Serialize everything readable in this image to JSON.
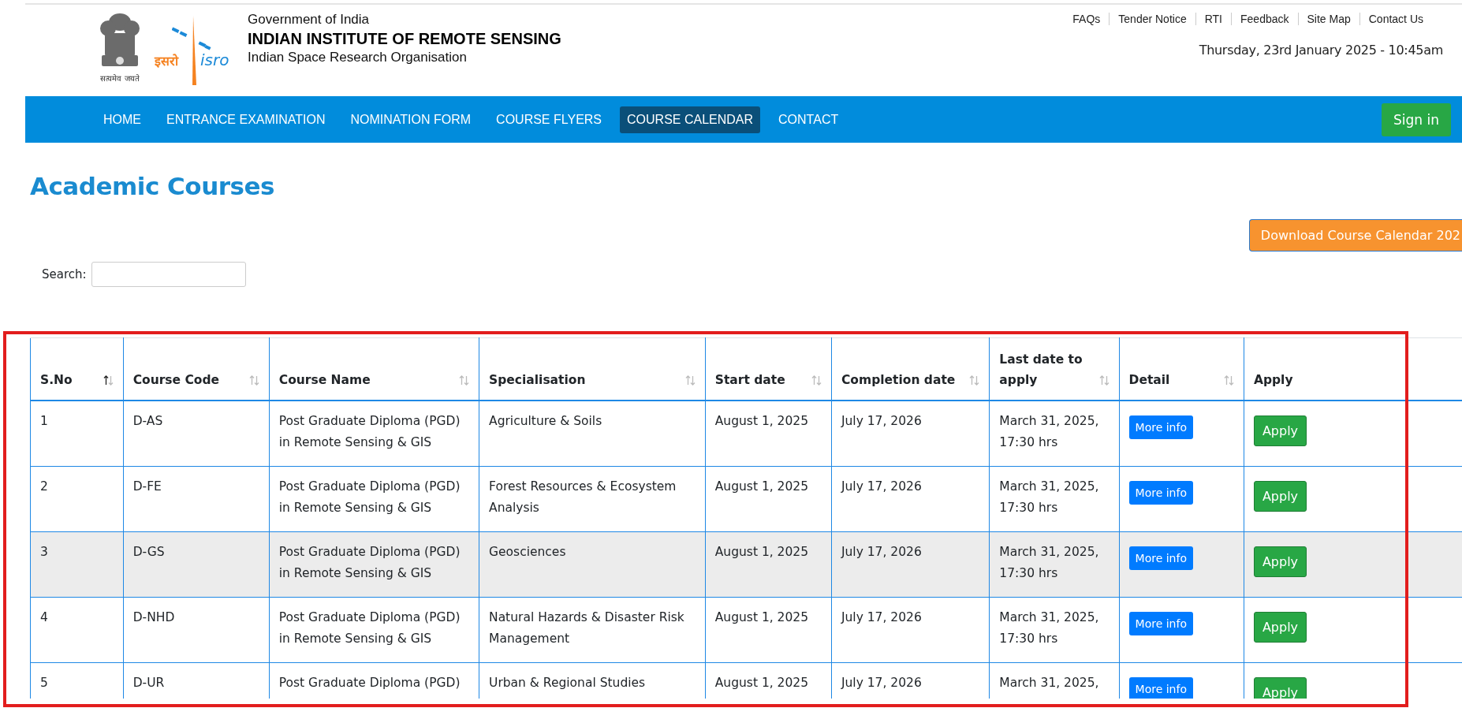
{
  "header": {
    "emblem_motto": "सत्यमेव जयते",
    "isro_logo": {
      "hindi": "इसरो",
      "latin": "isro"
    },
    "org_line": "Government of India",
    "institute": "INDIAN INSTITUTE OF REMOTE SENSING",
    "parent_org": "Indian Space Research Organisation",
    "top_links": [
      "FAQs",
      "Tender Notice",
      "RTI",
      "Feedback",
      "Site Map",
      "Contact Us"
    ],
    "datetime": "Thursday, 23rd January 2025 - 10:45am"
  },
  "nav": {
    "items": [
      {
        "label": "HOME",
        "selected": false
      },
      {
        "label": "ENTRANCE EXAMINATION",
        "selected": false
      },
      {
        "label": "NOMINATION FORM",
        "selected": false
      },
      {
        "label": "COURSE FLYERS",
        "selected": false
      },
      {
        "label": "COURSE CALENDAR",
        "selected": true
      },
      {
        "label": "CONTACT",
        "selected": false
      }
    ],
    "sign_in": "Sign in"
  },
  "page_title": "Academic Courses",
  "download_button": "Download Course Calendar 202",
  "search": {
    "label": "Search:"
  },
  "table": {
    "columns": [
      {
        "label": "S.No",
        "sorted": true
      },
      {
        "label": "Course Code",
        "sorted": false
      },
      {
        "label": "Course Name",
        "sorted": false
      },
      {
        "label": "Specialisation",
        "sorted": false
      },
      {
        "label": "Start date",
        "sorted": false
      },
      {
        "label": "Completion date",
        "sorted": false
      },
      {
        "label": "Last date to apply",
        "sorted": false
      },
      {
        "label": "Detail",
        "sorted": false
      },
      {
        "label": "Apply"
      }
    ],
    "rows": [
      {
        "sno": "1",
        "code": "D-AS",
        "name": "Post Graduate Diploma (PGD) in Remote Sensing & GIS",
        "specialisation": "Agriculture & Soils",
        "start": "August 1, 2025",
        "completion": "July 17, 2026",
        "last_date": "March 31, 2025, 17:30 hrs",
        "detail": "More info",
        "apply": "Apply",
        "highlighted": false
      },
      {
        "sno": "2",
        "code": "D-FE",
        "name": "Post Graduate Diploma (PGD) in Remote Sensing & GIS",
        "specialisation": "Forest Resources & Ecosystem Analysis",
        "start": "August 1, 2025",
        "completion": "July 17, 2026",
        "last_date": "March 31, 2025, 17:30 hrs",
        "detail": "More info",
        "apply": "Apply",
        "highlighted": false
      },
      {
        "sno": "3",
        "code": "D-GS",
        "name": "Post Graduate Diploma (PGD) in Remote Sensing & GIS",
        "specialisation": "Geosciences",
        "start": "August 1, 2025",
        "completion": "July 17, 2026",
        "last_date": "March 31, 2025, 17:30 hrs",
        "detail": "More info",
        "apply": "Apply",
        "highlighted": true
      },
      {
        "sno": "4",
        "code": "D-NHD",
        "name": "Post Graduate Diploma (PGD) in Remote Sensing & GIS",
        "specialisation": "Natural Hazards & Disaster Risk Management",
        "start": "August 1, 2025",
        "completion": "July 17, 2026",
        "last_date": "March 31, 2025, 17:30 hrs",
        "detail": "More info",
        "apply": "Apply",
        "highlighted": false
      },
      {
        "sno": "5",
        "code": "D-UR",
        "name": "Post Graduate Diploma (PGD)",
        "specialisation": "Urban & Regional Studies",
        "start": "August 1, 2025",
        "completion": "July 17, 2026",
        "last_date": "March 31, 2025,",
        "detail": "More info",
        "apply": "Apply",
        "highlighted": false
      }
    ]
  }
}
